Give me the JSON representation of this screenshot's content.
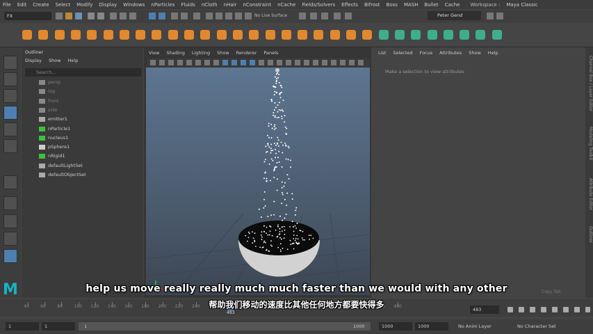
{
  "menubar": {
    "items": [
      "File",
      "Edit",
      "Create",
      "Select",
      "Modify",
      "Display",
      "Windows",
      "nParticles",
      "Fluids",
      "nCloth",
      "nHair",
      "nConstraint",
      "nCache",
      "Fields/Solvers",
      "Effects",
      "Bifrost",
      "Boss",
      "MASH",
      "Bullet",
      "Cache"
    ],
    "workspace_label": "Workspace :",
    "workspace_value": "Maya Classic"
  },
  "status_line": {
    "mode": "FX",
    "live_surface": "No Live Surface",
    "user": "Peter Gend"
  },
  "outliner": {
    "title": "Outliner",
    "menu": [
      "Display",
      "Show",
      "Help"
    ],
    "search_placeholder": "Search...",
    "items": [
      {
        "label": "persp",
        "dim": true
      },
      {
        "label": "top",
        "dim": true
      },
      {
        "label": "front",
        "dim": true
      },
      {
        "label": "side",
        "dim": true
      },
      {
        "label": "emitter1",
        "dim": false
      },
      {
        "label": "nParticle1",
        "dim": false
      },
      {
        "label": "nucleus1",
        "dim": false
      },
      {
        "label": "pSphere1",
        "dim": false
      },
      {
        "label": "nRigid1",
        "dim": false
      },
      {
        "label": "defaultLightSet",
        "dim": false
      },
      {
        "label": "defaultObjectSet",
        "dim": false
      }
    ]
  },
  "viewport": {
    "menu": [
      "View",
      "Shading",
      "Lighting",
      "Show",
      "Renderer",
      "Panels"
    ]
  },
  "attribute_editor": {
    "menu": [
      "List",
      "Selected",
      "Focus",
      "Attributes",
      "Show",
      "Help"
    ],
    "message": "Make a selection to view attributes",
    "copy_tab": "Copy Tab"
  },
  "side_tabs": [
    "Channel Box / Layer Editor",
    "Modeling Toolkit",
    "Attribute Editor",
    "Outliner"
  ],
  "timeline": {
    "ticks": [
      "40",
      "60",
      "80",
      "100",
      "120",
      "140",
      "160",
      "180",
      "200",
      "220",
      "240",
      "260",
      "280",
      "300",
      "320",
      "340",
      "360",
      "380",
      "400",
      "420",
      "440",
      "460",
      "480"
    ],
    "current_frame": "483",
    "current_frame_field": "483"
  },
  "range_slider": {
    "start": "1",
    "start_inner": "1",
    "range_start": "1",
    "range_end": "1000",
    "end_inner": "1000",
    "end": "1000",
    "anim_layer": "No Anim Layer",
    "character_set": "No Character Set"
  },
  "subtitles": {
    "english": "help us move really really much much faster than we would with any other",
    "chinese": "帮助我们移动的速度比其他任何地方都要快得多"
  },
  "colors": {
    "accent": "#4d7fb0",
    "shelf_icon": "#e0892f",
    "maya_logo": "#17b3c4"
  }
}
